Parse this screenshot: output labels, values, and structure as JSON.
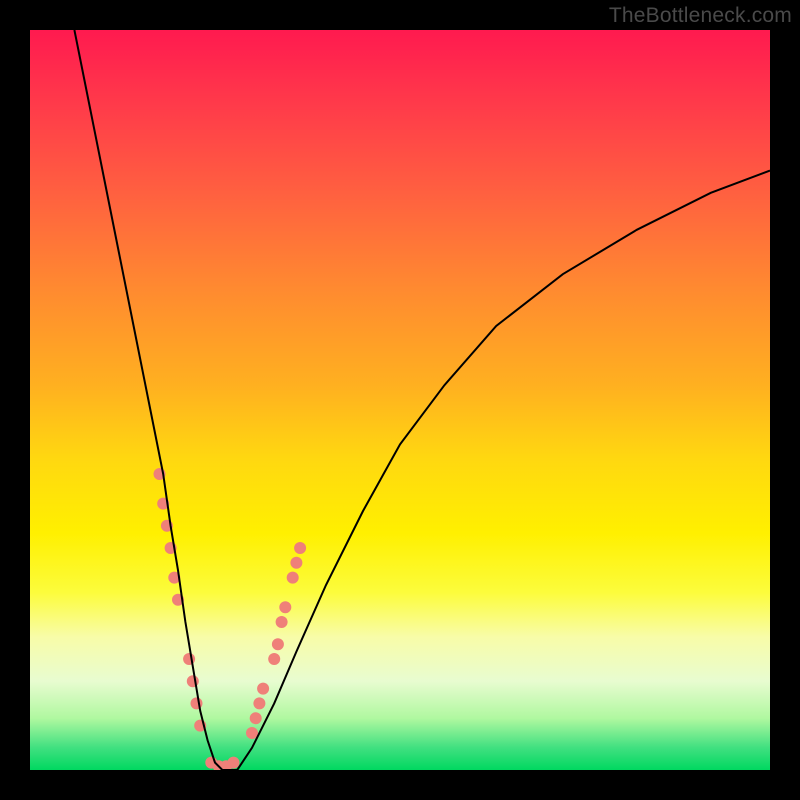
{
  "watermark": "TheBottleneck.com",
  "chart_data": {
    "type": "line",
    "title": "",
    "xlabel": "",
    "ylabel": "",
    "xlim": [
      0,
      100
    ],
    "ylim": [
      0,
      100
    ],
    "series": [
      {
        "name": "curve",
        "x": [
          6,
          8,
          10,
          12,
          14,
          16,
          18,
          19,
          20,
          21,
          22,
          23,
          24,
          25,
          26,
          28,
          30,
          33,
          36,
          40,
          45,
          50,
          56,
          63,
          72,
          82,
          92,
          100
        ],
        "values": [
          100,
          90,
          80,
          70,
          60,
          50,
          40,
          33,
          27,
          20,
          14,
          8,
          4,
          1,
          0,
          0,
          3,
          9,
          16,
          25,
          35,
          44,
          52,
          60,
          67,
          73,
          78,
          81
        ]
      }
    ],
    "dot_clusters": [
      {
        "x": 17.5,
        "y": 40
      },
      {
        "x": 18.0,
        "y": 36
      },
      {
        "x": 18.5,
        "y": 33
      },
      {
        "x": 19.0,
        "y": 30
      },
      {
        "x": 19.5,
        "y": 26
      },
      {
        "x": 20.0,
        "y": 23
      },
      {
        "x": 21.5,
        "y": 15
      },
      {
        "x": 22.0,
        "y": 12
      },
      {
        "x": 22.5,
        "y": 9
      },
      {
        "x": 23.0,
        "y": 6
      },
      {
        "x": 24.5,
        "y": 1
      },
      {
        "x": 25.5,
        "y": 0.5
      },
      {
        "x": 26.5,
        "y": 0.5
      },
      {
        "x": 27.5,
        "y": 1
      },
      {
        "x": 30.0,
        "y": 5
      },
      {
        "x": 30.5,
        "y": 7
      },
      {
        "x": 31.0,
        "y": 9
      },
      {
        "x": 31.5,
        "y": 11
      },
      {
        "x": 33.0,
        "y": 15
      },
      {
        "x": 33.5,
        "y": 17
      },
      {
        "x": 34.0,
        "y": 20
      },
      {
        "x": 34.5,
        "y": 22
      },
      {
        "x": 35.5,
        "y": 26
      },
      {
        "x": 36.0,
        "y": 28
      },
      {
        "x": 36.5,
        "y": 30
      }
    ],
    "dot_color": "#ef8079",
    "dot_radius": 6,
    "curve_stroke": "#000000",
    "curve_width": 2.0
  }
}
